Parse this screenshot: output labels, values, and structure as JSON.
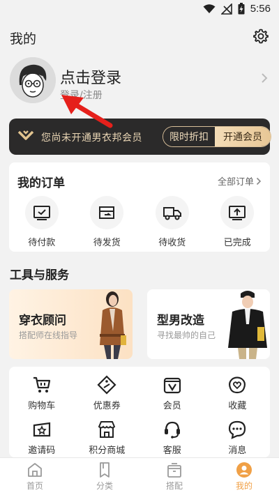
{
  "status_bar": {
    "time": "5:56"
  },
  "header": {
    "title": "我的"
  },
  "profile": {
    "login_title": "点击登录",
    "login_sub": "登录/注册"
  },
  "vip": {
    "text": "您尚未开通男衣邦会员",
    "limited_label": "限时折扣",
    "open_label": "开通会员"
  },
  "orders": {
    "title": "我的订单",
    "all_label": "全部订单",
    "items": [
      {
        "label": "待付款",
        "icon": "pending-payment-icon"
      },
      {
        "label": "待发货",
        "icon": "pending-shipment-icon"
      },
      {
        "label": "待收货",
        "icon": "delivery-truck-icon"
      },
      {
        "label": "已完成",
        "icon": "completed-icon"
      }
    ]
  },
  "services": {
    "title": "工具与服务",
    "promos": [
      {
        "title": "穿衣顾问",
        "subtitle": "搭配师在线指导"
      },
      {
        "title": "型男改造",
        "subtitle": "寻找最帅的自己"
      }
    ],
    "tools": [
      {
        "label": "购物车",
        "icon": "cart-icon"
      },
      {
        "label": "优惠券",
        "icon": "coupon-icon"
      },
      {
        "label": "会员",
        "icon": "member-icon"
      },
      {
        "label": "收藏",
        "icon": "favorite-icon"
      },
      {
        "label": "邀请码",
        "icon": "invite-code-icon"
      },
      {
        "label": "积分商城",
        "icon": "points-mall-icon"
      },
      {
        "label": "客服",
        "icon": "customer-service-icon"
      },
      {
        "label": "消息",
        "icon": "message-icon"
      }
    ]
  },
  "tabs": [
    {
      "label": "首页",
      "icon": "home-icon"
    },
    {
      "label": "分类",
      "icon": "category-icon"
    },
    {
      "label": "搭配",
      "icon": "outfit-icon"
    },
    {
      "label": "我的",
      "icon": "profile-icon",
      "active": true
    }
  ],
  "colors": {
    "accent": "#f0a046",
    "vip_bg": "#2b2a2a",
    "vip_gold": "#e9d5b4",
    "annotation_arrow": "#e5201b"
  }
}
